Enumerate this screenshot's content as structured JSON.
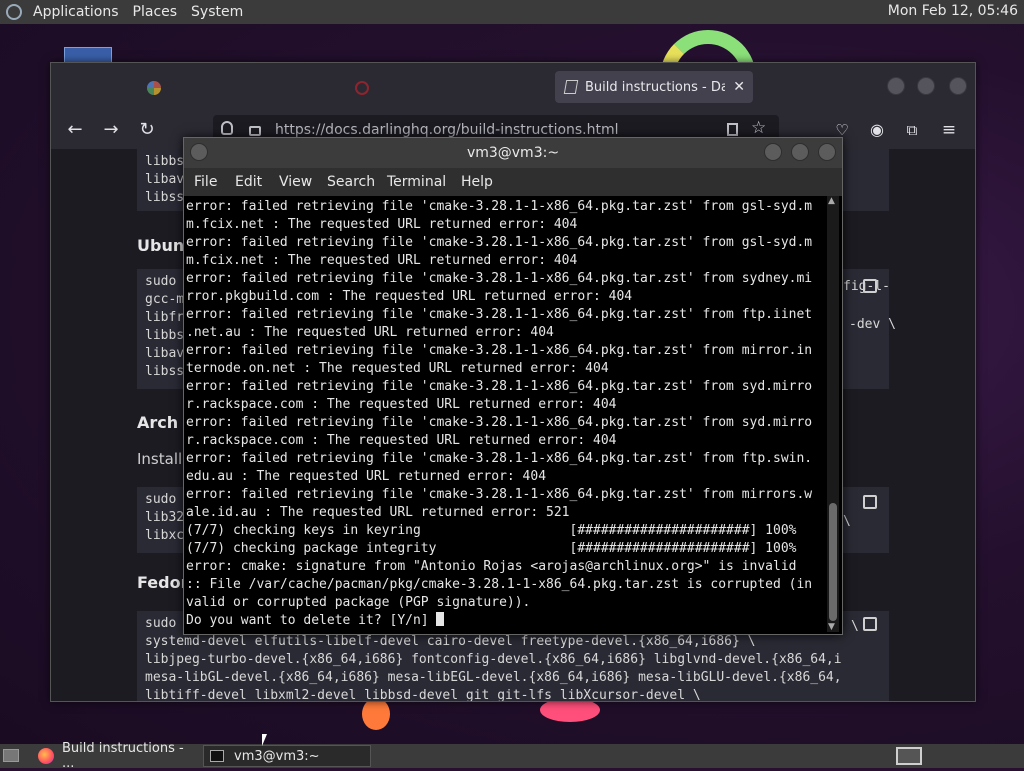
{
  "top_panel": {
    "menus": [
      "Applications",
      "Places",
      "System"
    ],
    "clock": "Mon Feb 12, 05:46"
  },
  "firefox": {
    "tabs": [
      {
        "label": "",
        "icon": "google-icon"
      },
      {
        "label": "",
        "icon": "opera-icon"
      },
      {
        "label": "Build instructions - Darlin",
        "icon": "page-icon",
        "active": true
      }
    ],
    "url": "https://docs.darlinghq.org/build-instructions.html",
    "page": {
      "headings": [
        "Ubunt",
        "Arch L",
        "Fedor"
      ],
      "install_text": "Install",
      "code_top": [
        "libbs",
        "libav",
        "libss"
      ],
      "code_ubuntu": [
        "sudo",
        "gcc-m",
        "libfr",
        "libbs",
        "libav",
        "libss"
      ],
      "code_arch": [
        "sudo",
        "lib32",
        "libxc"
      ],
      "code_fedora": [
        "sudo",
        "systemd-devel elfutils-libelf-devel cairo-devel freetype-devel.{x86_64,i686} \\",
        "libjpeg-turbo-devel.{x86_64,i686} fontconfig-devel.{x86_64,i686} libglvnd-devel.{x86_64,i",
        "mesa-libGL-devel.{x86_64,i686} mesa-libEGL-devel.{x86_64,i686} mesa-libGLU-devel.{x86_64,",
        "libtiff-devel libxml2-devel libbsd-devel git git-lfs libXcursor-devel \\"
      ],
      "right_fragments": [
        "fig-l-",
        "-dev \\",
        "\\",
        "\\"
      ]
    }
  },
  "terminal": {
    "title": "vm3@vm3:~",
    "menu": [
      "File",
      "Edit",
      "View",
      "Search",
      "Terminal",
      "Help"
    ],
    "lines": [
      "error: failed retrieving file 'cmake-3.28.1-1-x86_64.pkg.tar.zst' from gsl-syd.m",
      "m.fcix.net : The requested URL returned error: 404",
      "error: failed retrieving file 'cmake-3.28.1-1-x86_64.pkg.tar.zst' from gsl-syd.m",
      "m.fcix.net : The requested URL returned error: 404",
      "error: failed retrieving file 'cmake-3.28.1-1-x86_64.pkg.tar.zst' from sydney.mi",
      "rror.pkgbuild.com : The requested URL returned error: 404",
      "error: failed retrieving file 'cmake-3.28.1-1-x86_64.pkg.tar.zst' from ftp.iinet",
      ".net.au : The requested URL returned error: 404",
      "error: failed retrieving file 'cmake-3.28.1-1-x86_64.pkg.tar.zst' from mirror.in",
      "ternode.on.net : The requested URL returned error: 404",
      "error: failed retrieving file 'cmake-3.28.1-1-x86_64.pkg.tar.zst' from syd.mirro",
      "r.rackspace.com : The requested URL returned error: 404",
      "error: failed retrieving file 'cmake-3.28.1-1-x86_64.pkg.tar.zst' from syd.mirro",
      "r.rackspace.com : The requested URL returned error: 404",
      "error: failed retrieving file 'cmake-3.28.1-1-x86_64.pkg.tar.zst' from ftp.swin.",
      "edu.au : The requested URL returned error: 404",
      "error: failed retrieving file 'cmake-3.28.1-1-x86_64.pkg.tar.zst' from mirrors.w",
      "ale.id.au : The requested URL returned error: 521",
      "(7/7) checking keys in keyring                   [######################] 100%",
      "(7/7) checking package integrity                 [######################] 100%",
      "error: cmake: signature from \"Antonio Rojas <arojas@archlinux.org>\" is invalid",
      ":: File /var/cache/pacman/pkg/cmake-3.28.1-1-x86_64.pkg.tar.zst is corrupted (in",
      "valid or corrupted package (PGP signature)).",
      "Do you want to delete it? [Y/n] "
    ]
  },
  "taskbar": {
    "items": [
      {
        "label": "Build instructions - ...",
        "icon": "firefox-icon"
      },
      {
        "label": "vm3@vm3:~",
        "icon": "terminal-icon"
      }
    ]
  },
  "colors": {
    "panel": "#3b3b3b",
    "terminal_bg": "#000000",
    "browser_bg": "#1c1b22"
  }
}
